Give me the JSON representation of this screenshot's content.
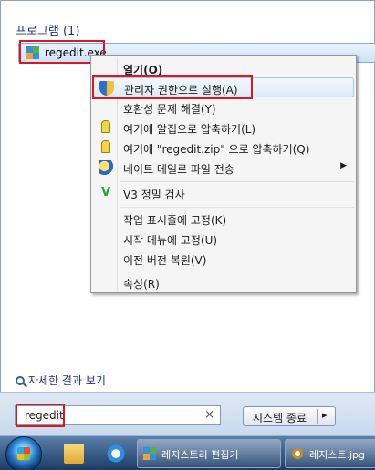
{
  "start_menu": {
    "section_header": "프로그램 (1)",
    "result_item": {
      "label": "regedit.exe",
      "icon": "regedit-icon"
    },
    "see_more": "자세한 결과 보기",
    "search": {
      "value": "regedit",
      "clear_symbol": "×"
    },
    "shutdown": {
      "label": "시스템 종료",
      "arrow": "▸"
    }
  },
  "context_menu": {
    "items": [
      {
        "label": "열기(O)",
        "bold": true
      },
      {
        "label": "관리자 권한으로 실행(A)",
        "icon": "uac-shield-icon"
      },
      {
        "label": "호환성 문제 해결(Y)"
      },
      {
        "label": "여기에 알집으로 압축하기(L)",
        "icon": "alzip-icon"
      },
      {
        "label": "여기에 \"regedit.zip\" 으로 압축하기(Q)",
        "icon": "alzip-icon"
      },
      {
        "label": "네이트 메일로 파일 전송",
        "icon": "nate-mail-icon",
        "submenu_arrow": "▶"
      },
      {
        "label": "V3 정밀 검사",
        "icon": "v3-icon",
        "icon_text": "V"
      },
      {
        "label": "작업 표시줄에 고정(K)"
      },
      {
        "label": "시작 메뉴에 고정(U)"
      },
      {
        "label": "이전 버전 복원(V)"
      },
      {
        "label": "속성(R)"
      }
    ]
  },
  "taskbar": {
    "buttons": [
      {
        "label": "레지스트리 편집기",
        "icon": "regedit-icon"
      },
      {
        "label": "레지스트.jpg",
        "icon": "image-viewer-icon"
      }
    ]
  },
  "colors": {
    "highlight_box": "#e0151d",
    "menu_hover": "#dfeafa",
    "taskbar": "#1c3c63"
  }
}
